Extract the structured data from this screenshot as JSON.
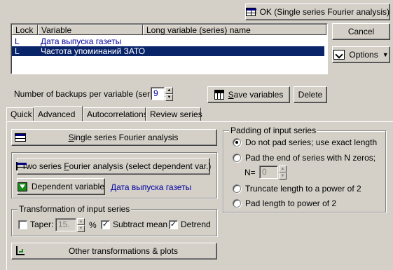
{
  "ok_button": {
    "label": "OK (Single series Fourier analysis)"
  },
  "cancel_button": {
    "label": "Cancel"
  },
  "options_button": {
    "label": "Options"
  },
  "variables_table": {
    "columns": [
      "Lock",
      "Variable",
      "Long variable (series) name"
    ],
    "rows": [
      {
        "lock": "L",
        "variable": "Дата выпуска газеты",
        "long_name": ""
      },
      {
        "lock": "L",
        "variable": "Частота упоминаний ЗАТО",
        "long_name": ""
      }
    ]
  },
  "backups": {
    "label": "Number of backups per variable (series):",
    "value": "9"
  },
  "save_variables_button": {
    "label_first": "S",
    "label_rest": "ave variables"
  },
  "delete_button": {
    "label": "Delete"
  },
  "tabs": [
    {
      "label": "Quick"
    },
    {
      "label": "Advanced"
    },
    {
      "label": "Autocorrelations"
    },
    {
      "label": "Review series"
    }
  ],
  "single_series_button": {
    "label_first": "S",
    "label_rest": "ingle series Fourier analysis"
  },
  "two_series_button": {
    "label_a": "Two series ",
    "label_u": "F",
    "label_b": "ourier analysis (select dependent var.)"
  },
  "dependent_variable": {
    "label": "Dependent variable",
    "value": "Дата выпуска газеты"
  },
  "transformation": {
    "title": "Transformation of input series",
    "taper_label": "Taper:",
    "taper_value": "15.",
    "taper_unit": "%",
    "subtract_mean_label": "Subtract mean",
    "detrend_label": "Detrend",
    "taper_checked": false,
    "subtract_mean_checked": true,
    "detrend_checked": true
  },
  "padding": {
    "title": "Padding of input series",
    "options": [
      "Do not pad series; use exact length",
      "Pad the end of series with N zeros;",
      "Truncate length to a power of 2",
      "Pad length to power of 2"
    ],
    "selected_index": 0,
    "n_label": "N=",
    "n_value": "0"
  },
  "other_transformations_button": {
    "label": "Other transformations & plots"
  },
  "colors": {
    "selection": "#0a246a",
    "link_text": "#0000a0"
  }
}
